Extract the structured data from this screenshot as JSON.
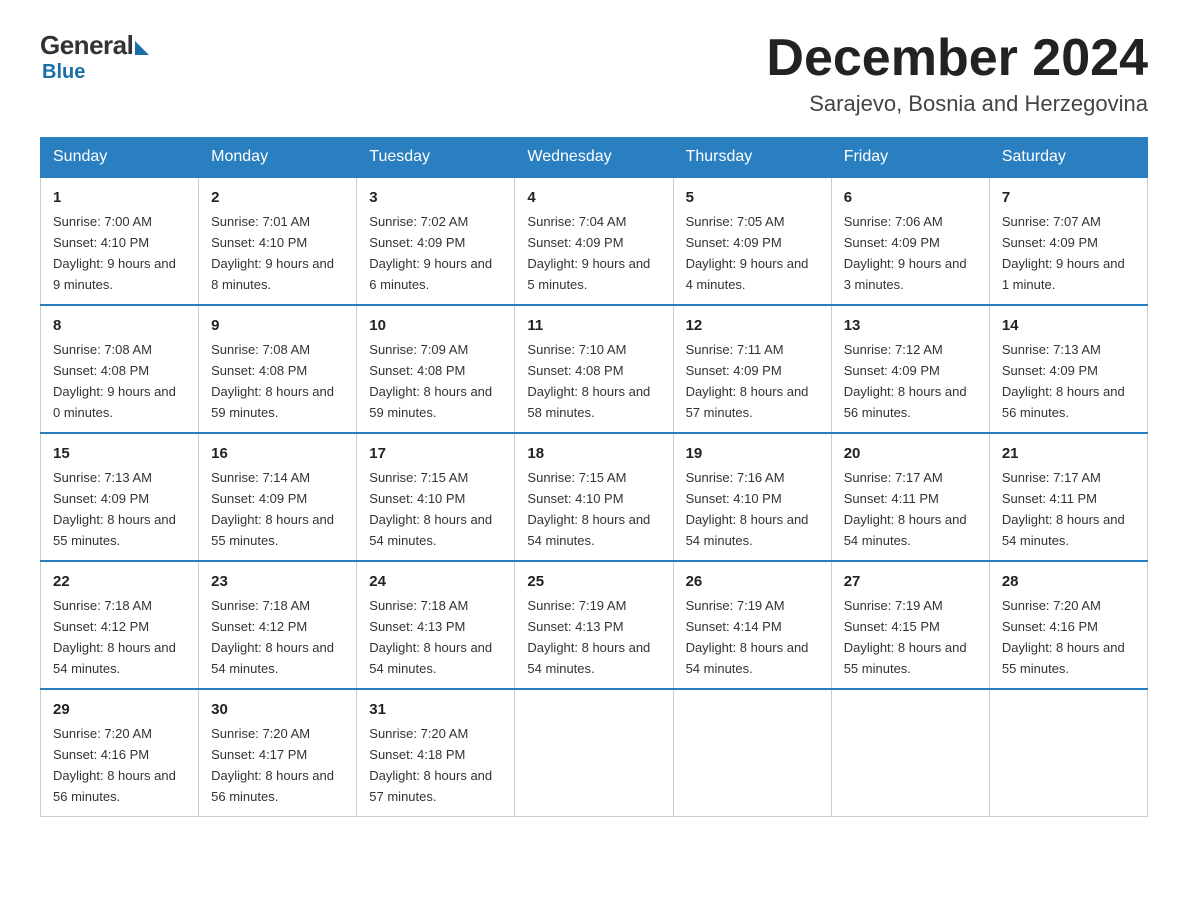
{
  "logo": {
    "general": "General",
    "blue": "Blue"
  },
  "header": {
    "month": "December 2024",
    "location": "Sarajevo, Bosnia and Herzegovina"
  },
  "weekdays": [
    "Sunday",
    "Monday",
    "Tuesday",
    "Wednesday",
    "Thursday",
    "Friday",
    "Saturday"
  ],
  "weeks": [
    [
      {
        "day": "1",
        "sunrise": "7:00 AM",
        "sunset": "4:10 PM",
        "daylight": "9 hours and 9 minutes."
      },
      {
        "day": "2",
        "sunrise": "7:01 AM",
        "sunset": "4:10 PM",
        "daylight": "9 hours and 8 minutes."
      },
      {
        "day": "3",
        "sunrise": "7:02 AM",
        "sunset": "4:09 PM",
        "daylight": "9 hours and 6 minutes."
      },
      {
        "day": "4",
        "sunrise": "7:04 AM",
        "sunset": "4:09 PM",
        "daylight": "9 hours and 5 minutes."
      },
      {
        "day": "5",
        "sunrise": "7:05 AM",
        "sunset": "4:09 PM",
        "daylight": "9 hours and 4 minutes."
      },
      {
        "day": "6",
        "sunrise": "7:06 AM",
        "sunset": "4:09 PM",
        "daylight": "9 hours and 3 minutes."
      },
      {
        "day": "7",
        "sunrise": "7:07 AM",
        "sunset": "4:09 PM",
        "daylight": "9 hours and 1 minute."
      }
    ],
    [
      {
        "day": "8",
        "sunrise": "7:08 AM",
        "sunset": "4:08 PM",
        "daylight": "9 hours and 0 minutes."
      },
      {
        "day": "9",
        "sunrise": "7:08 AM",
        "sunset": "4:08 PM",
        "daylight": "8 hours and 59 minutes."
      },
      {
        "day": "10",
        "sunrise": "7:09 AM",
        "sunset": "4:08 PM",
        "daylight": "8 hours and 59 minutes."
      },
      {
        "day": "11",
        "sunrise": "7:10 AM",
        "sunset": "4:08 PM",
        "daylight": "8 hours and 58 minutes."
      },
      {
        "day": "12",
        "sunrise": "7:11 AM",
        "sunset": "4:09 PM",
        "daylight": "8 hours and 57 minutes."
      },
      {
        "day": "13",
        "sunrise": "7:12 AM",
        "sunset": "4:09 PM",
        "daylight": "8 hours and 56 minutes."
      },
      {
        "day": "14",
        "sunrise": "7:13 AM",
        "sunset": "4:09 PM",
        "daylight": "8 hours and 56 minutes."
      }
    ],
    [
      {
        "day": "15",
        "sunrise": "7:13 AM",
        "sunset": "4:09 PM",
        "daylight": "8 hours and 55 minutes."
      },
      {
        "day": "16",
        "sunrise": "7:14 AM",
        "sunset": "4:09 PM",
        "daylight": "8 hours and 55 minutes."
      },
      {
        "day": "17",
        "sunrise": "7:15 AM",
        "sunset": "4:10 PM",
        "daylight": "8 hours and 54 minutes."
      },
      {
        "day": "18",
        "sunrise": "7:15 AM",
        "sunset": "4:10 PM",
        "daylight": "8 hours and 54 minutes."
      },
      {
        "day": "19",
        "sunrise": "7:16 AM",
        "sunset": "4:10 PM",
        "daylight": "8 hours and 54 minutes."
      },
      {
        "day": "20",
        "sunrise": "7:17 AM",
        "sunset": "4:11 PM",
        "daylight": "8 hours and 54 minutes."
      },
      {
        "day": "21",
        "sunrise": "7:17 AM",
        "sunset": "4:11 PM",
        "daylight": "8 hours and 54 minutes."
      }
    ],
    [
      {
        "day": "22",
        "sunrise": "7:18 AM",
        "sunset": "4:12 PM",
        "daylight": "8 hours and 54 minutes."
      },
      {
        "day": "23",
        "sunrise": "7:18 AM",
        "sunset": "4:12 PM",
        "daylight": "8 hours and 54 minutes."
      },
      {
        "day": "24",
        "sunrise": "7:18 AM",
        "sunset": "4:13 PM",
        "daylight": "8 hours and 54 minutes."
      },
      {
        "day": "25",
        "sunrise": "7:19 AM",
        "sunset": "4:13 PM",
        "daylight": "8 hours and 54 minutes."
      },
      {
        "day": "26",
        "sunrise": "7:19 AM",
        "sunset": "4:14 PM",
        "daylight": "8 hours and 54 minutes."
      },
      {
        "day": "27",
        "sunrise": "7:19 AM",
        "sunset": "4:15 PM",
        "daylight": "8 hours and 55 minutes."
      },
      {
        "day": "28",
        "sunrise": "7:20 AM",
        "sunset": "4:16 PM",
        "daylight": "8 hours and 55 minutes."
      }
    ],
    [
      {
        "day": "29",
        "sunrise": "7:20 AM",
        "sunset": "4:16 PM",
        "daylight": "8 hours and 56 minutes."
      },
      {
        "day": "30",
        "sunrise": "7:20 AM",
        "sunset": "4:17 PM",
        "daylight": "8 hours and 56 minutes."
      },
      {
        "day": "31",
        "sunrise": "7:20 AM",
        "sunset": "4:18 PM",
        "daylight": "8 hours and 57 minutes."
      },
      null,
      null,
      null,
      null
    ]
  ]
}
